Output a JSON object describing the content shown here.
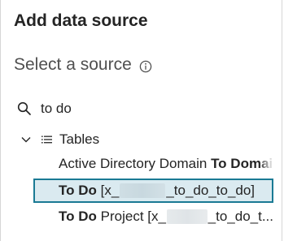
{
  "dialog": {
    "title": "Add data source",
    "subtitle": "Select a source"
  },
  "icons": {
    "info": "info-icon",
    "search": "search-icon",
    "expand": "chevron-down-icon",
    "tables": "list-icon"
  },
  "search": {
    "value": "to do",
    "placeholder": ""
  },
  "tree": {
    "group_label": "Tables",
    "items": [
      {
        "prefix": "Active Directory Domain ",
        "match": "To Do",
        "suffix": "main",
        "selected": false
      },
      {
        "match": "To Do",
        "suffix_before_redaction": " [x_",
        "suffix_after_redaction": "_to_do_to_do]",
        "selected": true
      },
      {
        "match": "To Do",
        "suffix_before_redaction": " Project [x_",
        "suffix_after_redaction": "_to_do_t...",
        "selected": false
      }
    ]
  },
  "colors": {
    "selected_background": "#daeaf0",
    "selected_border": "#1a7a94",
    "text": "#242424",
    "subtitle": "#505050"
  }
}
